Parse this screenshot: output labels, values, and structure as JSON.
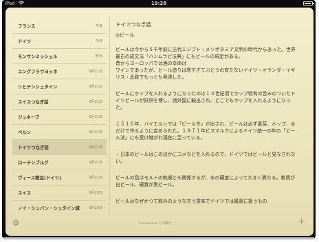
{
  "statusbar": {
    "carrier": "iPad",
    "time": "19:28"
  },
  "notes": [
    {
      "title": "フランス",
      "date": "今日"
    },
    {
      "title": "ドイツ",
      "date": "今日"
    },
    {
      "title": "モンサンミッシェル",
      "date": "昨日"
    },
    {
      "title": "ユングフラウヨッホ",
      "date": "9月21日"
    },
    {
      "title": "リヒテンシュタイン",
      "date": "9月21日"
    },
    {
      "title": "スイスつなぎ話",
      "date": "9月21日"
    },
    {
      "title": "ジュネーブ",
      "date": "9月21日"
    },
    {
      "title": "ベルン",
      "date": "9月21日"
    },
    {
      "title": "ドイツつなぎ話",
      "date": "9月21日"
    },
    {
      "title": "ローテンブルグ",
      "date": "9月21日"
    },
    {
      "title": "ヴィース教会(ドイツ)",
      "date": "9月21日"
    },
    {
      "title": "スイス",
      "date": "9月20日"
    },
    {
      "title": "ノイ・シュバン・シュタイン城",
      "date": "9月20日"
    }
  ],
  "note": {
    "title": "ドイツつなぎ話",
    "heading": "◎ビール",
    "paragraphs": [
      "ビールは今から５千年前に古代エジプト・メソポタミア文明の時代からあった。世界最古の成文法「ハンムラビ法典」にもビールの規定がある。\n昔からヨーロッパでは酒の本命は\nワインであったが、ビール造りは寒すぎてぶどうの育たないドイツ・オランダ・イギリス・北欧でもっとも発達した。",
      "ビールにホップを入れるようになったのは１４世紀頃でホップ特有の苦みのついたドイツビールが好評を博し、諸外国に輸出され、どこでもホップを入れるようになった。",
      "１５１６年、バイエルンでは「ビール令」が出され、ビールは必ず麦芽、ホップ、水だけで作るように定められた。１８７１年ビスマルクによるドイツ統一の年の「ビール法」にも受け継がれ現在に至っている。",
      "・日本のビールはこのほかにコメなどを入れるので、ドイツではビールと見なされない。",
      "ビールの色はモルトの乾燥とも関係するが、水の硬度によって大きく異なる。軟質が白ビール、硬質が黒ビール。",
      "ビールはなぜかつて飲みのような言う意味でドイツでは最重に扱うもの"
    ]
  },
  "footer": {
    "status": "Gimmebook と同期中・・・"
  }
}
